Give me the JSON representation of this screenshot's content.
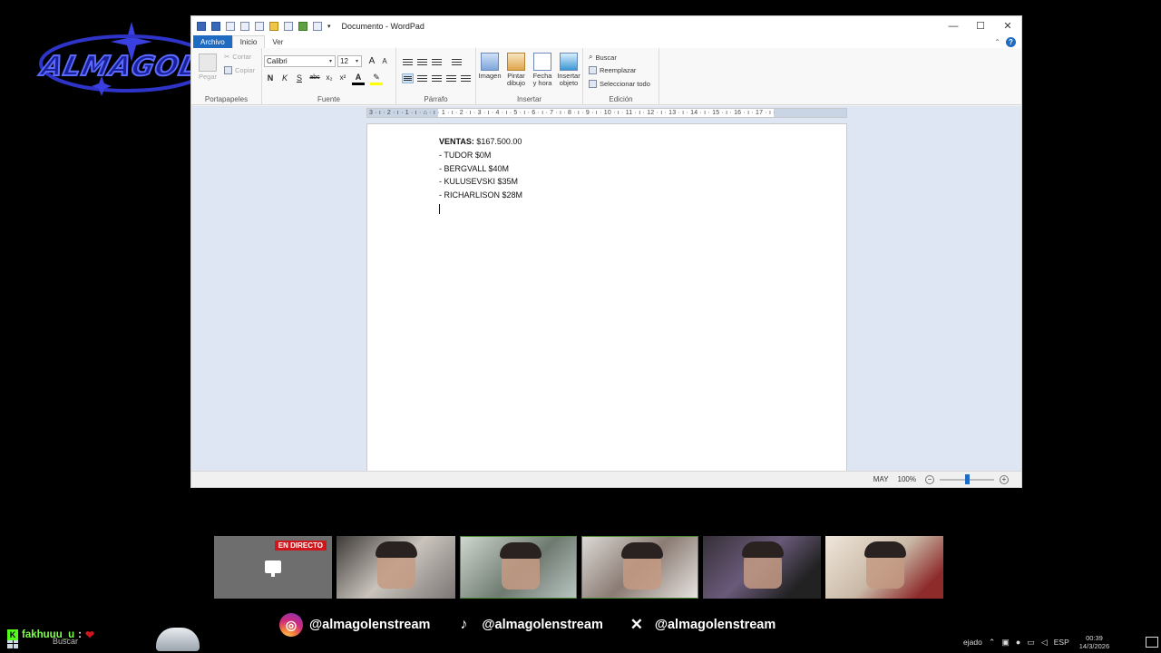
{
  "overlay": {
    "logo_text": "ALMAGOL",
    "live_badge": "EN DIRECTO",
    "chat": {
      "user": "fakhuuu_u",
      "separator": ":",
      "message": "❤"
    },
    "socials": [
      {
        "icon": "instagram-icon",
        "handle": "@almagolenstream"
      },
      {
        "icon": "tiktok-icon",
        "handle": "@almagolenstream"
      },
      {
        "icon": "x-icon",
        "handle": "@almagolenstream"
      }
    ]
  },
  "window": {
    "title": "Documento - WordPad",
    "controls": {
      "minimize": "—",
      "maximize": "☐",
      "close": "✕"
    }
  },
  "ribbon": {
    "tabs": [
      "Archivo",
      "Inicio",
      "Ver"
    ],
    "help": "?",
    "clipboard": {
      "paste": "Pegar",
      "cut": "Cortar",
      "copy": "Copiar",
      "label": "Portapapeles"
    },
    "font": {
      "family": "Calibri",
      "size": "12",
      "bold": "N",
      "italic": "K",
      "underline": "S",
      "strike": "abc",
      "subscript": "x₂",
      "superscript": "x²",
      "grow": "A",
      "shrink": "A",
      "color": "A",
      "label": "Fuente"
    },
    "paragraph": {
      "label": "Párrafo"
    },
    "insert": {
      "image": "Imagen",
      "paint_line1": "Pintar",
      "paint_line2": "dibujo",
      "datetime_line1": "Fecha",
      "datetime_line2": "y hora",
      "object_line1": "Insertar",
      "object_line2": "objeto",
      "label": "Insertar"
    },
    "editing": {
      "find": "Buscar",
      "replace": "Reemplazar",
      "select_all": "Seleccionar todo",
      "label": "Edición"
    }
  },
  "ruler": {
    "text": "3 · ı · 2 · ı · 1 · ı · ⌂ · ı · 1 · ı · 2 · ı · 3 · ı · 4 · ı · 5 · ı · 6 · ı · 7 · ı · 8 · ı · 9 · ı · 10 · ı · 11 · ı · 12 · ı · 13 · ı · 14 · ı · 15 · ı · 16 · ı · 17 · ı ·"
  },
  "document": {
    "heading_bold": "VENTAS:",
    "heading_value": " $167.500.00",
    "lines": [
      "- TUDOR $0M",
      "- BERGVALL $40M",
      "- KULUSEVSKI $35M",
      "- RICHARLISON $28M"
    ]
  },
  "statusbar": {
    "caps": "MAY",
    "zoom": "100%",
    "zoom_out": "−",
    "zoom_in": "+",
    "zoom_level": 0.5
  },
  "taskbar": {
    "search": "Buscar",
    "weather_fragment": "ejado",
    "lang": "ESP",
    "time": "00:39",
    "date": "14/3/2026"
  }
}
